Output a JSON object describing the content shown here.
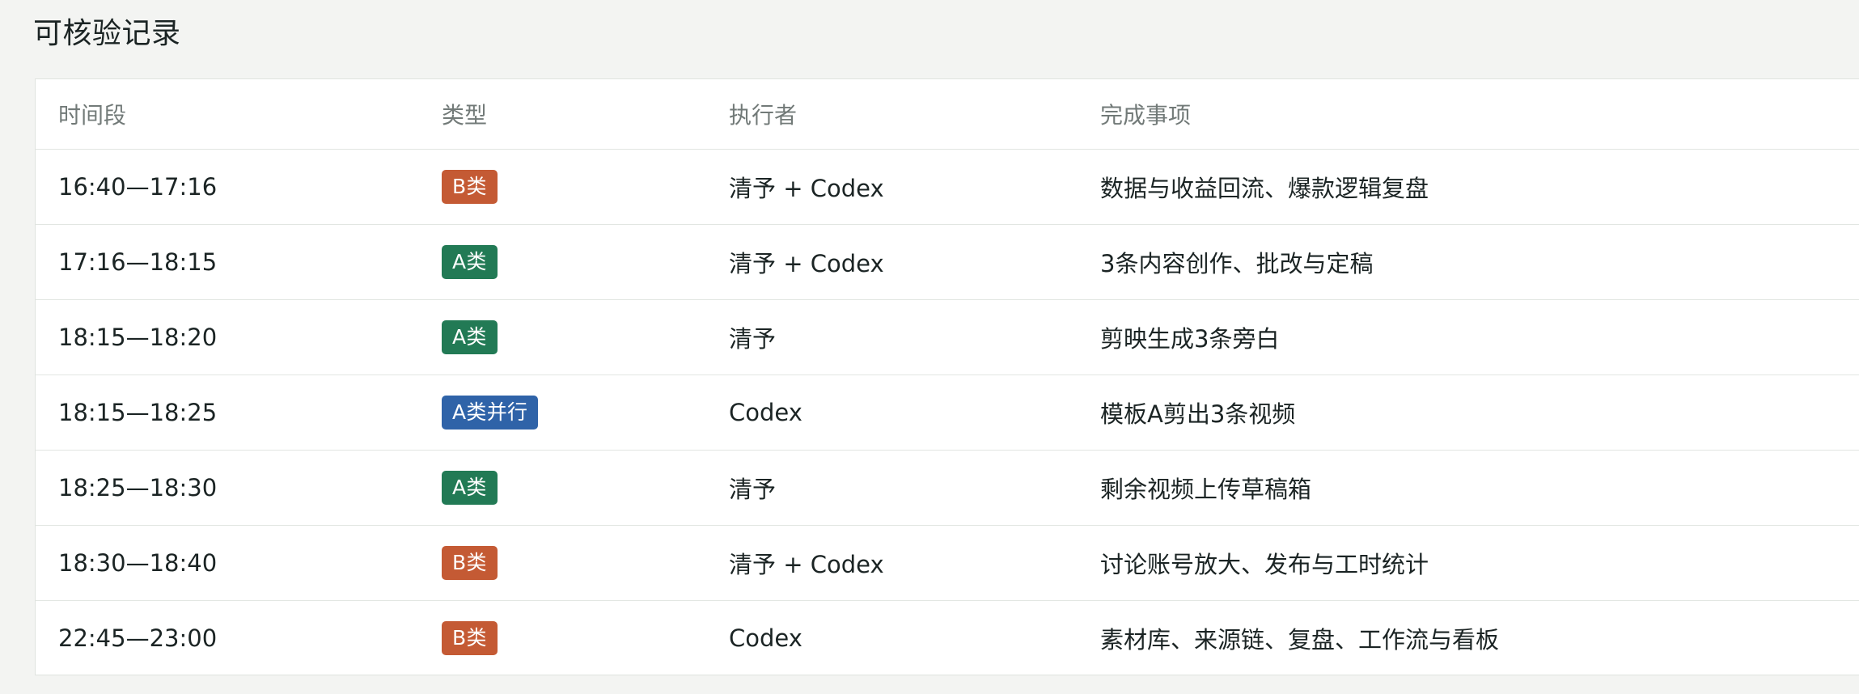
{
  "section": {
    "title": "可核验记录"
  },
  "table": {
    "headers": [
      "时间段",
      "类型",
      "执行者",
      "完成事项"
    ],
    "rows": [
      {
        "time": "16:40—17:16",
        "type": "B类",
        "type_kind": "b",
        "executor": "清予 + Codex",
        "task": "数据与收益回流、爆款逻辑复盘"
      },
      {
        "time": "17:16—18:15",
        "type": "A类",
        "type_kind": "a",
        "executor": "清予 + Codex",
        "task": "3条内容创作、批改与定稿"
      },
      {
        "time": "18:15—18:20",
        "type": "A类",
        "type_kind": "a",
        "executor": "清予",
        "task": "剪映生成3条旁白"
      },
      {
        "time": "18:15—18:25",
        "type": "A类并行",
        "type_kind": "ap",
        "executor": "Codex",
        "task": "模板A剪出3条视频"
      },
      {
        "time": "18:25—18:30",
        "type": "A类",
        "type_kind": "a",
        "executor": "清予",
        "task": "剩余视频上传草稿箱"
      },
      {
        "time": "18:30—18:40",
        "type": "B类",
        "type_kind": "b",
        "executor": "清予 + Codex",
        "task": "讨论账号放大、发布与工时统计"
      },
      {
        "time": "22:45—23:00",
        "type": "B类",
        "type_kind": "b",
        "executor": "Codex",
        "task": "素材库、来源链、复盘、工作流与看板"
      }
    ]
  },
  "colors": {
    "b_badge": "#c45a34",
    "a_badge": "#227a55",
    "a_parallel_badge": "#2f63a8"
  }
}
